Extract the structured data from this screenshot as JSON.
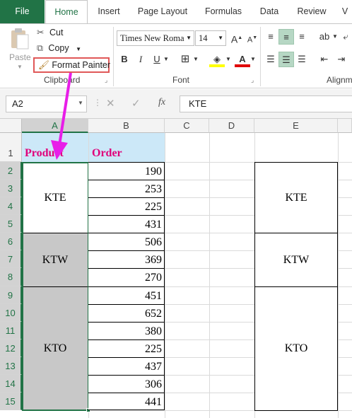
{
  "tabs": [
    "File",
    "Home",
    "Insert",
    "Page Layout",
    "Formulas",
    "Data",
    "Review",
    "V"
  ],
  "clipboard": {
    "paste": "Paste",
    "cut": "Cut",
    "copy": "Copy",
    "format_painter": "Format Painter",
    "group_label": "Clipboard"
  },
  "font": {
    "name": "Times New Roma",
    "size": "14",
    "group_label": "Font"
  },
  "alignment": {
    "group_label": "Alignm"
  },
  "formula_bar": {
    "name_box": "A2",
    "value": "KTE",
    "fx": "fx"
  },
  "columns": [
    "A",
    "B",
    "C",
    "D",
    "E"
  ],
  "rows": [
    "1",
    "2",
    "3",
    "4",
    "5",
    "6",
    "7",
    "8",
    "9",
    "10",
    "11",
    "12",
    "13",
    "14",
    "15"
  ],
  "headers": {
    "product": "Product",
    "order": "Order"
  },
  "orders": [
    "190",
    "253",
    "225",
    "431",
    "506",
    "369",
    "270",
    "451",
    "652",
    "380",
    "225",
    "437",
    "306",
    "441"
  ],
  "products": [
    {
      "label": "KTE",
      "rows": [
        2,
        5
      ]
    },
    {
      "label": "KTW",
      "rows": [
        6,
        8
      ]
    },
    {
      "label": "KTO",
      "rows": [
        9,
        15
      ]
    }
  ],
  "colors": {
    "accent": "#217346",
    "header_fill": "#cce8f8",
    "header_text": "#e0007a",
    "gray_fill": "#c8c8c8",
    "highlight_box": "#e05858",
    "arrow": "#e81ee8"
  }
}
